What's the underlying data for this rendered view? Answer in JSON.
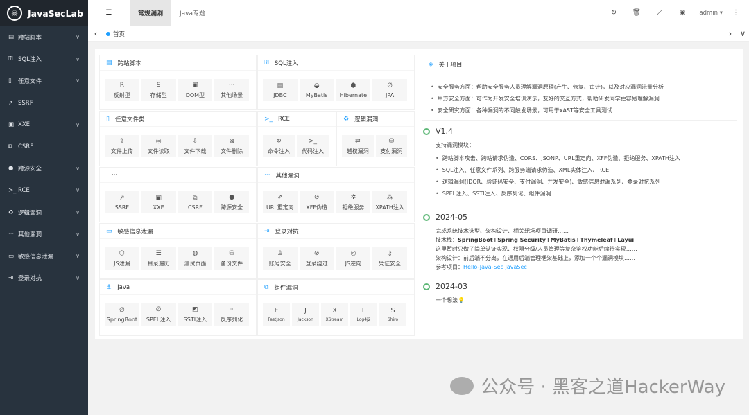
{
  "app": {
    "logo_text": "JavaSecLab",
    "logo_icon": "ninja-logo-icon"
  },
  "sidebar": {
    "items": [
      {
        "icon": "▤",
        "label": "跨站脚本",
        "has_children": true
      },
      {
        "icon": "⚿",
        "label": "SQL注入",
        "has_children": true
      },
      {
        "icon": "▯",
        "label": "任意文件",
        "has_children": true
      },
      {
        "icon": "↗",
        "label": "SSRF",
        "has_children": false
      },
      {
        "icon": "▣",
        "label": "XXE",
        "has_children": true
      },
      {
        "icon": "⧉",
        "label": "CSRF",
        "has_children": false
      },
      {
        "icon": "●",
        "label": "跨源安全",
        "has_children": true
      },
      {
        "icon": ">_",
        "label": "RCE",
        "has_children": true
      },
      {
        "icon": "♻",
        "label": "逻辑漏洞",
        "has_children": true
      },
      {
        "icon": "···",
        "label": "其他漏洞",
        "has_children": true
      },
      {
        "icon": "▭",
        "label": "敏感信息泄漏",
        "has_children": true
      },
      {
        "icon": "⇥",
        "label": "登录对抗",
        "has_children": true
      }
    ],
    "chevron": "∨"
  },
  "header": {
    "menu_icon": "☰",
    "tabs": [
      {
        "label": "常规漏洞",
        "active": true
      },
      {
        "label": "Java专题",
        "active": false
      }
    ],
    "icons": [
      "↻",
      "🗑",
      "⤢",
      "◉"
    ],
    "user": "admin ▾",
    "more": "⋮"
  },
  "breadcrumb": {
    "prev": "‹",
    "home": "首页",
    "next": "›",
    "collapse": "∨"
  },
  "cards": [
    {
      "title": "跨站脚本",
      "icon": "▤",
      "tiles": [
        [
          "R",
          "反射型"
        ],
        [
          "S",
          "存储型"
        ],
        [
          "▣",
          "DOM型"
        ],
        [
          "···",
          "其他场景"
        ]
      ]
    },
    {
      "title": "SQL注入",
      "icon": "⚿",
      "tiles": [
        [
          "▤",
          "JDBC"
        ],
        [
          "◒",
          "MyBatis"
        ],
        [
          "⬢",
          "Hibernate"
        ],
        [
          "∅",
          "JPA"
        ]
      ]
    },
    {
      "title": "任意文件类",
      "icon": "▯",
      "tiles": [
        [
          "⇪",
          "文件上传"
        ],
        [
          "◎",
          "文件读取"
        ],
        [
          "⇩",
          "文件下载"
        ],
        [
          "⊠",
          "文件删除"
        ]
      ]
    },
    {
      "title": "RCE",
      "icon": ">_",
      "tiles": [
        [
          "↻",
          "命令注入"
        ],
        [
          ">_",
          "代码注入"
        ]
      ]
    },
    {
      "title": "逻辑漏洞",
      "icon": "♻",
      "tiles": [
        [
          "⇄",
          "越权漏洞"
        ],
        [
          "⛁",
          "支付漏洞"
        ]
      ]
    },
    {
      "title": "···",
      "icon": "",
      "tiles": [
        [
          "↗",
          "SSRF"
        ],
        [
          "▣",
          "XXE"
        ],
        [
          "⧉",
          "CSRF"
        ],
        [
          "●",
          "跨源安全"
        ]
      ]
    },
    {
      "title": "其他漏洞",
      "icon": "···",
      "tiles": [
        [
          "⇗",
          "URL重定向"
        ],
        [
          "⊘",
          "XFF伪造"
        ],
        [
          "✲",
          "拒绝服务"
        ],
        [
          "⁂",
          "XPATH注入"
        ]
      ]
    },
    {
      "title": "敏感信息泄漏",
      "icon": "▭",
      "tiles": [
        [
          "⬡",
          "JS泄漏"
        ],
        [
          "☰",
          "目录遍历"
        ],
        [
          "◍",
          "测试页面"
        ],
        [
          "⛁",
          "备份文件"
        ]
      ]
    },
    {
      "title": "登录对抗",
      "icon": "⇥",
      "tiles": [
        [
          "♙",
          "账号安全"
        ],
        [
          "⊘",
          "登录绕过"
        ],
        [
          "◎",
          "JS逆向"
        ],
        [
          "⚷",
          "凭证安全"
        ]
      ]
    },
    {
      "title": "Java",
      "icon": "⚓",
      "tiles": [
        [
          "∅",
          "SpringBoot"
        ],
        [
          "∅",
          "SPEL注入"
        ],
        [
          "◩",
          "SSTI注入"
        ],
        [
          "⌗",
          "反序列化"
        ]
      ]
    },
    {
      "title": "组件漏洞",
      "icon": "⧉",
      "tiles": [
        [
          "F",
          "Fastjson"
        ],
        [
          "J",
          "Jackson"
        ],
        [
          "X",
          "XStream"
        ],
        [
          "L",
          "Log4j2"
        ],
        [
          "S",
          "Shiro"
        ]
      ]
    }
  ],
  "about": {
    "title": "关于项目",
    "icon": "◈",
    "items": [
      "安全服务方面：帮助安全服务人员理解漏洞原理(产生、修复、审计)，以及对应漏洞流量分析",
      "甲方安全方面：可作为开发安全培训演示，友好的交互方式，帮助研发同学更容易理解漏洞",
      "安全研究方面：各种漏洞的不同触发场景，可用于xAST等安全工具测试"
    ]
  },
  "timeline": [
    {
      "title": "V1.4",
      "intro": "支持漏洞模块：",
      "items": [
        "跨站脚本攻击、跨站请求伪造、CORS、JSONP、URL重定向、XFF伪造、拒绝服务、XPATH注入",
        "SQL注入、任意文件系列、跨服务端请求伪造、XML实体注入、RCE",
        "逻辑漏洞(IDOR、验证码安全、支付漏洞、并发安全)、敏感信息泄漏系列、登录对抗系列",
        "SPEL注入、SSTI注入、反序列化、组件漏洞"
      ]
    },
    {
      "title": "2024-05",
      "line1": "完成系统技术选型、架构设计、相关靶场项目调研……",
      "line2_label": "技术栈：",
      "line2_value": "SpringBoot+Spring Security+MyBatis+Thymeleaf+Layui",
      "line3": "这里暂时只做了简单认证实现、权限分级/人员管理等复杂鉴权功能后续待实现……",
      "line4": "架构设计：前后端不分离，在通用后端管理框架基础上，添加一个个漏洞模块……",
      "line5_label": "参考项目：",
      "line5_link": "Hello-Java-Sec JavaSec"
    },
    {
      "title": "2024-03",
      "line1": "一个想法💡"
    }
  ],
  "watermark": "公众号 · 黑客之道HackerWay"
}
